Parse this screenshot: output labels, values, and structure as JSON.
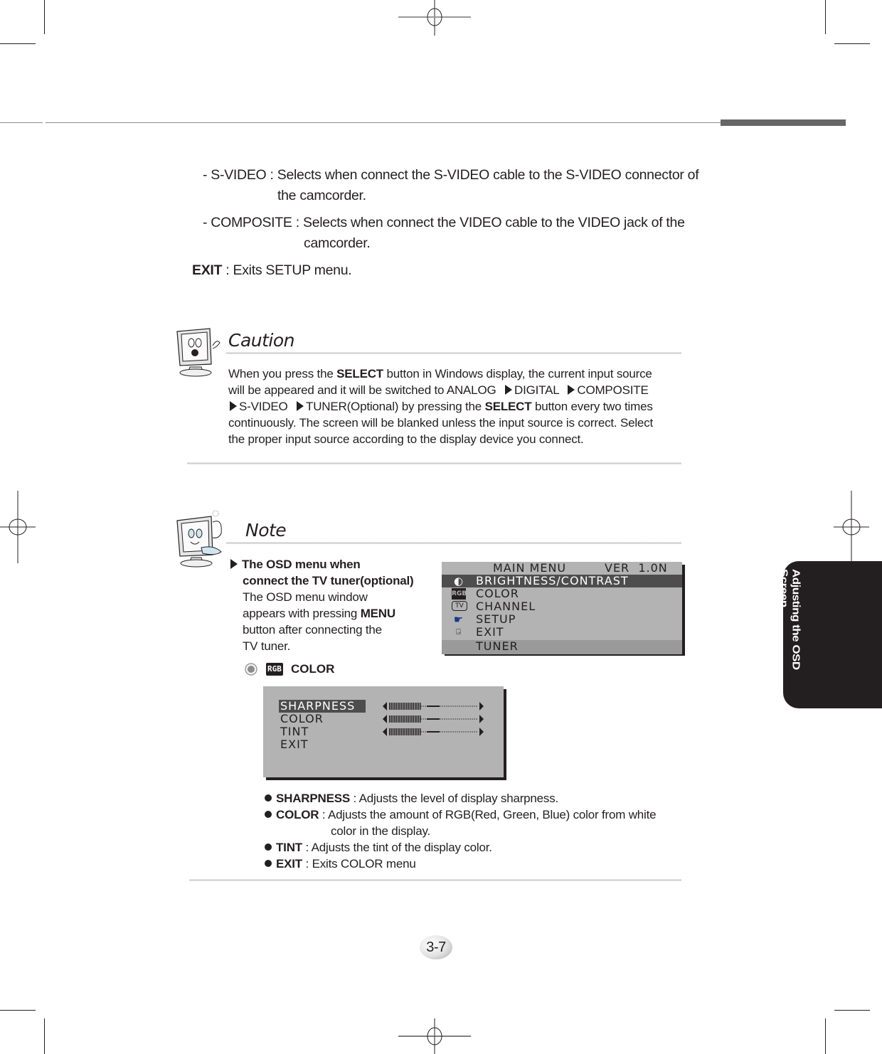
{
  "header": {
    "side_tab_label": "Adjusting the OSD Screen"
  },
  "setup_items": {
    "svideo": {
      "prefix": "- S-VIDEO : ",
      "line1": "Selects when connect the S-VIDEO cable to the S-VIDEO connector of",
      "line2": "the camcorder."
    },
    "composite": {
      "prefix": "- COMPOSITE : ",
      "line1": "Selects when connect the VIDEO cable to the VIDEO jack of the",
      "line2": "camcorder."
    },
    "exit": {
      "term": "EXIT",
      "desc": " : Exits SETUP menu."
    }
  },
  "caution": {
    "title": "Caution",
    "icon": "monitor-mascot-caution-icon",
    "l1_a": "When you press the ",
    "l1_b": "SELECT",
    "l1_c": " button in Windows display, the current input source",
    "l2_a": "will be appeared and it will be switched to ANALOG ",
    "l2_b": "DIGITAL ",
    "l2_c": "COMPOSITE",
    "l3_a": "S-VIDEO ",
    "l3_b": "TUNER(Optional) by pressing the ",
    "l3_c": "SELECT",
    "l3_d": " button every two times",
    "l4": "continuously. The screen will be blanked unless the input source is correct. Select",
    "l5": "the proper input source according to the display device you connect.",
    "arrow_icon": "triangle-right-icon"
  },
  "note": {
    "title": "Note",
    "icon": "monitor-mascot-note-icon",
    "heading1": "The OSD menu when",
    "heading2": "connect the TV tuner(optional)",
    "p1": "The OSD menu window",
    "p2_a": "appears with pressing ",
    "p2_b": "MENU",
    "p3": "button after connecting the",
    "p4": "TV tuner.",
    "color_label": "COLOR",
    "color_badge": "RGB",
    "radio_icon": "radio-dot-icon"
  },
  "osd_main_menu": {
    "title": "MAIN MENU",
    "version": "VER  1.0N",
    "items": [
      {
        "label": "BRIGHTNESS/CONTRAST",
        "icon": "brightness-icon",
        "glyph": "◐",
        "selected": true
      },
      {
        "label": "COLOR",
        "icon": "rgb-icon",
        "glyph": "RGB",
        "selected": false
      },
      {
        "label": "CHANNEL",
        "icon": "tv-icon",
        "glyph": "TV",
        "selected": false
      },
      {
        "label": "SETUP",
        "icon": "hand-pointer-icon",
        "glyph": "☛",
        "selected": false
      },
      {
        "label": "EXIT",
        "icon": "exit-door-icon",
        "glyph": "⍈",
        "selected": false
      },
      {
        "label": "TUNER",
        "icon": "",
        "glyph": "",
        "selected": false
      }
    ]
  },
  "osd_color_menu": {
    "items": [
      {
        "label": "SHARPNESS",
        "selected": true,
        "level": 0.35
      },
      {
        "label": "COLOR",
        "selected": false,
        "level": 0.35
      },
      {
        "label": "TINT",
        "selected": false,
        "level": 0.35
      },
      {
        "label": "EXIT",
        "selected": false
      }
    ]
  },
  "color_descriptions": [
    {
      "term": "SHARPNESS",
      "desc": " : Adjusts the level of display sharpness."
    },
    {
      "term": "COLOR",
      "desc": " : Adjusts the amount of RGB(Red, Green, Blue) color from white",
      "desc2": "color in the display."
    },
    {
      "term": "TINT",
      "desc": " : Adjusts the tint of the display color."
    },
    {
      "term": "EXIT",
      "desc": " : Exits COLOR menu"
    }
  ],
  "footer": {
    "page_number": "3-7"
  },
  "colors": {
    "text": "#231f20",
    "osd_bg": "#b3b3b3",
    "osd_selected": "#4d4d4d",
    "side_tab": "#231f20"
  }
}
